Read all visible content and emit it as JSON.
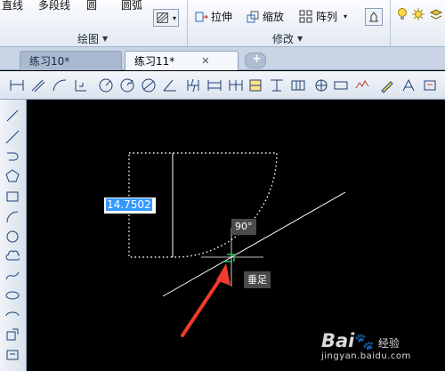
{
  "ribbon": {
    "draw_group": {
      "line": "直线",
      "polyline": "多段线",
      "circle": "圆",
      "arc": "圆弧",
      "label": "绘图"
    },
    "modify_group": {
      "stretch": "拉伸",
      "scale": "缩放",
      "array": "阵列",
      "label": "修改"
    }
  },
  "tabs": [
    {
      "label": "练习10*"
    },
    {
      "label": "练习11*"
    }
  ],
  "canvas": {
    "dim_input_value": "14.7502",
    "angle_tooltip": "90°",
    "snap_tooltip": "垂足"
  },
  "watermark": {
    "logo": "Bai",
    "logo2": "经验",
    "url": "jingyan.baidu.com"
  },
  "colors": {
    "background": "#000000",
    "selection": "#3399ff",
    "snap_marker": "#22c55e",
    "arrow": "#ef3b2d"
  }
}
